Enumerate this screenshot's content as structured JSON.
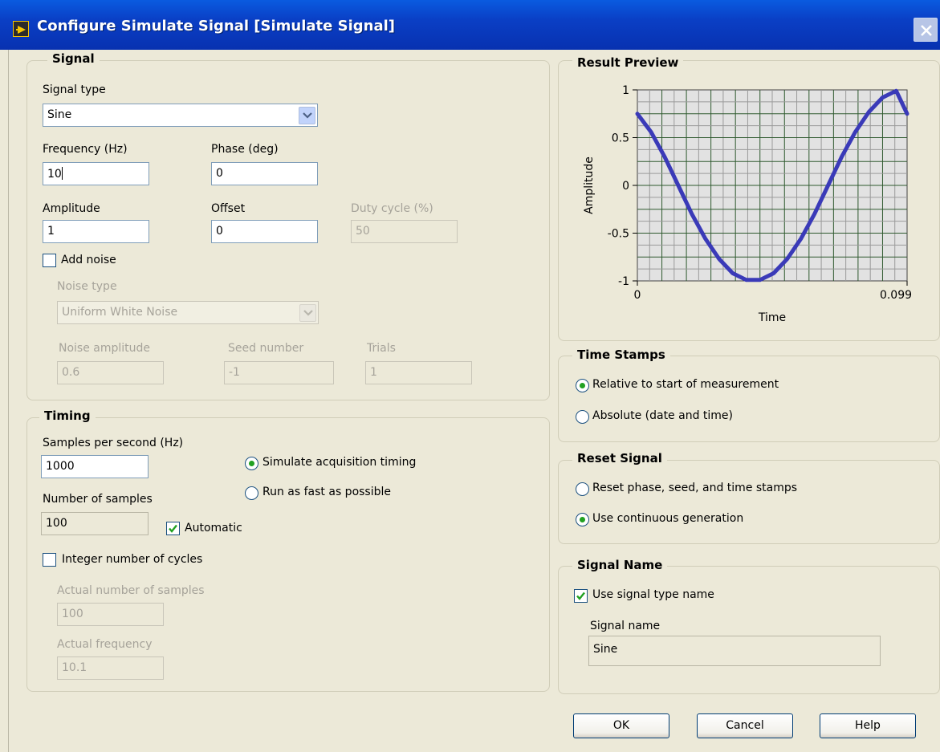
{
  "window": {
    "title": "Configure Simulate Signal [Simulate Signal]"
  },
  "signal": {
    "group_label": "Signal",
    "signal_type_label": "Signal type",
    "signal_type_value": "Sine",
    "frequency_label": "Frequency (Hz)",
    "frequency_value": "10",
    "phase_label": "Phase (deg)",
    "phase_value": "0",
    "amplitude_label": "Amplitude",
    "amplitude_value": "1",
    "offset_label": "Offset",
    "offset_value": "0",
    "duty_cycle_label": "Duty cycle (%)",
    "duty_cycle_value": "50",
    "add_noise_label": "Add noise",
    "add_noise_checked": false,
    "noise_type_label": "Noise type",
    "noise_type_value": "Uniform White Noise",
    "noise_amplitude_label": "Noise amplitude",
    "noise_amplitude_value": "0.6",
    "seed_label": "Seed number",
    "seed_value": "-1",
    "trials_label": "Trials",
    "trials_value": "1"
  },
  "timing": {
    "group_label": "Timing",
    "samples_per_second_label": "Samples per second (Hz)",
    "samples_per_second_value": "1000",
    "simulate_timing_label": "Simulate acquisition timing",
    "run_fast_label": "Run as fast as possible",
    "timing_mode_selected": "simulate",
    "num_samples_label": "Number of samples",
    "num_samples_value": "100",
    "automatic_label": "Automatic",
    "automatic_checked": true,
    "integer_cycles_label": "Integer number of cycles",
    "integer_cycles_checked": false,
    "actual_samples_label": "Actual number of samples",
    "actual_samples_value": "100",
    "actual_frequency_label": "Actual frequency",
    "actual_frequency_value": "10.1"
  },
  "result_preview": {
    "group_label": "Result Preview"
  },
  "chart_data": {
    "type": "line",
    "xlabel": "Time",
    "ylabel": "Amplitude",
    "xlim": [
      0,
      0.099
    ],
    "ylim": [
      -1,
      1
    ],
    "x_ticks": [
      "0",
      "0.099"
    ],
    "y_ticks": [
      "1",
      "0.5",
      "0",
      "-0.5",
      "-1"
    ],
    "grid": true,
    "series": [
      {
        "color": "#3a3ab8",
        "x": [
          0,
          0.005,
          0.01,
          0.015,
          0.02,
          0.025,
          0.03,
          0.035,
          0.04,
          0.045,
          0.05,
          0.055,
          0.06,
          0.065,
          0.07,
          0.075,
          0.08,
          0.085,
          0.09,
          0.095,
          0.099
        ],
        "y": [
          0.75,
          0.56,
          0.3,
          0.0,
          -0.3,
          -0.56,
          -0.77,
          -0.92,
          -0.99,
          -0.99,
          -0.92,
          -0.77,
          -0.56,
          -0.3,
          0.0,
          0.3,
          0.56,
          0.77,
          0.92,
          0.99,
          0.75
        ]
      }
    ]
  },
  "time_stamps": {
    "group_label": "Time Stamps",
    "relative_label": "Relative to start of measurement",
    "absolute_label": "Absolute (date and time)",
    "selected": "relative"
  },
  "reset_signal": {
    "group_label": "Reset Signal",
    "reset_label": "Reset phase, seed, and time stamps",
    "continuous_label": "Use continuous generation",
    "selected": "continuous"
  },
  "signal_name": {
    "group_label": "Signal Name",
    "use_type_name_label": "Use signal type name",
    "use_type_name_checked": true,
    "name_label": "Signal name",
    "name_value": "Sine"
  },
  "buttons": {
    "ok": "OK",
    "cancel": "Cancel",
    "help": "Help"
  },
  "icons": {
    "app": "labview-express-icon",
    "close": "close-icon",
    "dropdown": "chevron-down-icon",
    "check": "checkmark-icon"
  }
}
